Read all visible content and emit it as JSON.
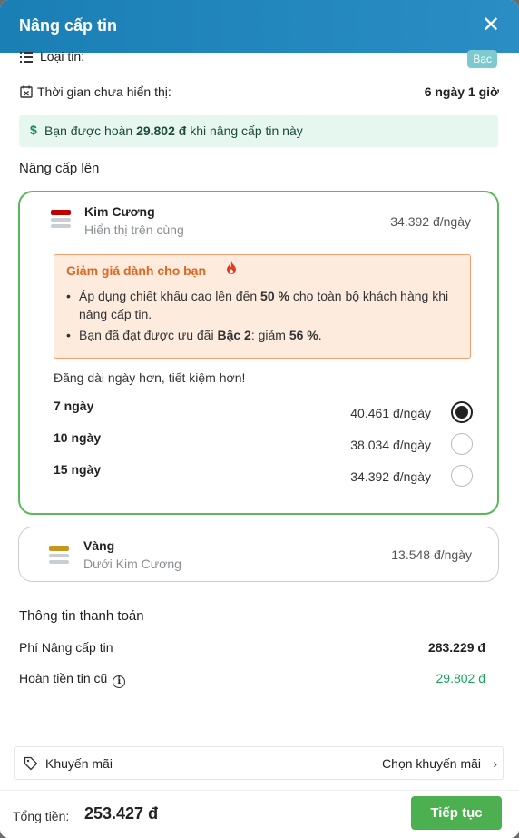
{
  "header": {
    "title": "Nâng cấp tin",
    "close_icon": "close-icon"
  },
  "listing": {
    "type_label": "Loại tin:",
    "type_value": "Bạc",
    "time_label": "Thời gian chưa hiển thị:",
    "time_value": "6 ngày 1 giờ"
  },
  "refund_notice": {
    "prefix": "Bạn được hoàn ",
    "amount": "29.802 đ",
    "suffix": " khi nâng cấp tin này"
  },
  "upgrade": {
    "section_title": "Nâng cấp lên",
    "packages": [
      {
        "name": "Kim Cương",
        "subtitle": "Hiển thị trên cùng",
        "price": "34.392 đ/ngày",
        "accent": "#c00000",
        "discount": {
          "title": "Giảm giá dành cho bạn",
          "bullet1_a": "Áp dụng chiết khấu cao lên đến ",
          "bullet1_b": "50 %",
          "bullet1_c": " cho toàn bộ khách hàng khi nâng cấp tin.",
          "bullet2_a": "Bạn đã đạt được ưu đãi ",
          "bullet2_b": "Bậc 2",
          "bullet2_c": ": giảm ",
          "bullet2_d": "56 %",
          "bullet2_e": "."
        },
        "longer_text": "Đăng dài ngày hơn, tiết kiệm hơn!",
        "options": [
          {
            "days": "7 ngày",
            "price": "40.461 đ/ngày",
            "selected": true
          },
          {
            "days": "10 ngày",
            "price": "38.034 đ/ngày",
            "selected": false
          },
          {
            "days": "15 ngày",
            "price": "34.392 đ/ngày",
            "selected": false
          }
        ]
      },
      {
        "name": "Vàng",
        "subtitle": "Dưới Kim Cương",
        "price": "13.548 đ/ngày",
        "accent": "#c8961e"
      }
    ]
  },
  "payment": {
    "section_title": "Thông tin thanh toán",
    "fee_label": "Phí Nâng cấp tin",
    "fee_value": "283.229 đ",
    "refund_label": "Hoàn tiền tin cũ",
    "refund_value": "29.802 đ",
    "refund_color": "#1aa35c"
  },
  "promo": {
    "label": "Khuyến mãi",
    "action": "Chọn khuyến mãi"
  },
  "footer": {
    "total_label": "Tổng tiền:",
    "total_value": "253.427 đ",
    "continue_label": "Tiếp tục"
  }
}
